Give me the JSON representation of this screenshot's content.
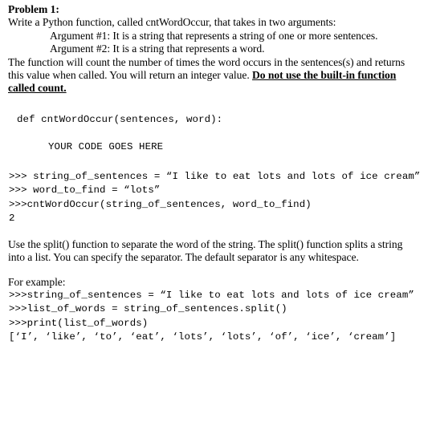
{
  "document": {
    "title": "Problem 1:",
    "intro": "Write a Python function, called cntWordOccur, that takes in two arguments:",
    "arguments": [
      "Argument #1:  It is a string that represents a string of one or more sentences.",
      "Argument #2:  It is a string that represents a word."
    ],
    "description": {
      "text_before_emphasis": "The function will count the number of times the word occurs in the sentences(s) and returns this value when called.  You will return an integer value.  ",
      "emphasized": "Do not use the built-in function called count."
    },
    "function_stub": {
      "signature": "def cntWordOccur(sentences, word):",
      "body_placeholder": "YOUR CODE GOES HERE"
    },
    "repl_example_1": [
      ">>> string_of_sentences = “I like to eat lots and lots of ice cream”",
      ">>> word_to_find = “lots”",
      ">>>cntWordOccur(string_of_sentences, word_to_find)",
      "2"
    ],
    "split_explanation": "Use the split() function to separate the word of the string.  The split()  function splits a string into a list.  You can specify the separator.  The default separator is any whitespace.",
    "example_label": "For example:",
    "repl_example_2": [
      ">>>string_of_sentences = “I like to eat lots and lots of ice cream”",
      ">>>list_of_words = string_of_sentences.split()",
      ">>>print(list_of_words)",
      "[‘I’, ‘like’, ‘to’, ‘eat’, ‘lots’, ‘lots’, ‘of’, ‘ice’, ‘cream’]"
    ]
  }
}
